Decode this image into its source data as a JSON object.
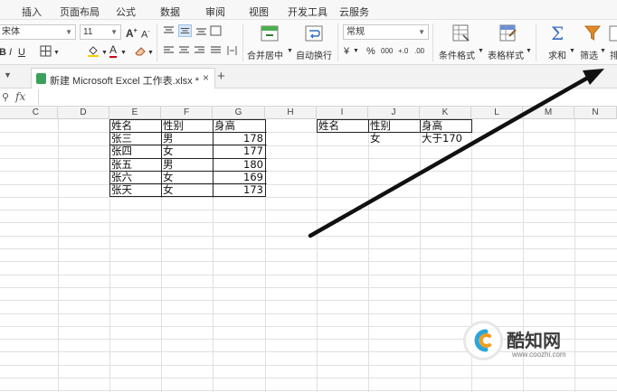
{
  "menu_tabs": [
    "插入",
    "页面布局",
    "公式",
    "数据",
    "审阅",
    "视图",
    "开发工具",
    "云服务"
  ],
  "ribbon": {
    "font_name": "宋体",
    "font_size": "11",
    "grow_font": "A",
    "shrink_font": "A",
    "number_format": "常规",
    "merge_center": "合并居中",
    "wrap_text": "自动换行",
    "currency": "¥",
    "percent": "%",
    "comma": "000",
    "inc_decimal": "+.0",
    "dec_decimal": ".00",
    "cond_format": "条件格式",
    "table_style": "表格样式",
    "sum_label": "求和",
    "filter_label": "筛选",
    "sort_label": "排",
    "bold": "B",
    "italic": "I",
    "underline": "U",
    "font_color": "A"
  },
  "doc_tab": {
    "title": "新建 Microsoft Excel 工作表.xlsx *",
    "close": "×",
    "add": "+"
  },
  "formula_bar": {
    "fx": "fx",
    "value": ""
  },
  "columns": [
    "C",
    "D",
    "E",
    "F",
    "G",
    "H",
    "I",
    "J",
    "K",
    "L",
    "M",
    "N"
  ],
  "table1": {
    "headers": [
      "姓名",
      "性别",
      "身高"
    ],
    "rows": [
      [
        "张三",
        "男",
        "178"
      ],
      [
        "张四",
        "女",
        "177"
      ],
      [
        "张五",
        "男",
        "180"
      ],
      [
        "张六",
        "女",
        "169"
      ],
      [
        "张天",
        "女",
        "173"
      ]
    ]
  },
  "criteria": {
    "headers": [
      "姓名",
      "性别",
      "身高"
    ],
    "row": [
      "",
      "女",
      "大于170"
    ]
  },
  "watermark": {
    "name": "酷知网",
    "url": "www.coozhi.com"
  },
  "colors": {
    "arrow": "#111111",
    "filter_icon": "#e08a2a",
    "sum_icon": "#3a6fc4"
  }
}
